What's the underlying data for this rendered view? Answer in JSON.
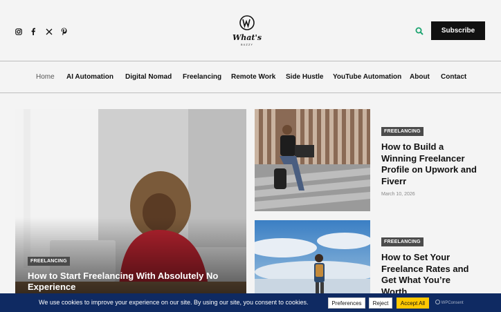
{
  "header": {
    "social": [
      "instagram-icon",
      "facebook-icon",
      "x-icon",
      "pinterest-icon"
    ],
    "logo_text": "What's",
    "logo_subtext": "BUZZY",
    "subscribe_label": "Subscribe"
  },
  "nav": {
    "items": [
      {
        "label": "Home",
        "active": true
      },
      {
        "label": "AI Automation"
      },
      {
        "label": "Digital Nomad"
      },
      {
        "label": "Freelancing"
      },
      {
        "label": "Remote Work"
      },
      {
        "label": "Side Hustle"
      },
      {
        "label": "YouTube Automation"
      },
      {
        "label": "About"
      },
      {
        "label": "Contact"
      }
    ]
  },
  "featured": {
    "tag": "FREELANCING",
    "title": "How to Start Freelancing With Absolutely No Experience"
  },
  "posts": [
    {
      "tag": "FREELANCING",
      "title": "How to Build a Winning Freelancer Profile on Upwork and Fiverr",
      "date": "March 10, 2026"
    },
    {
      "tag": "FREELANCING",
      "title": "How to Set Your Freelance Rates and Get What You’re Worth"
    }
  ],
  "cookie": {
    "text": "We use cookies to improve your experience on our site. By using our site, you consent to cookies.",
    "preferences": "Preferences",
    "reject": "Reject",
    "accept": "Accept All",
    "brand": "WPConsent"
  },
  "colors": {
    "accent_green": "#1aa36f",
    "cookie_bg": "#0f2a62",
    "accept": "#ffc800"
  }
}
